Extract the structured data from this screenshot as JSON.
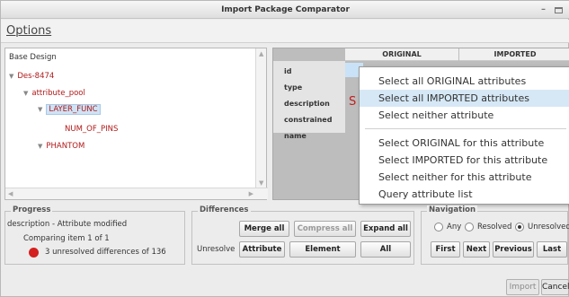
{
  "window": {
    "title": "Import Package Comparator"
  },
  "options_label": "Options",
  "tree": {
    "header": "Base Design",
    "items": [
      {
        "label": "Des-8474",
        "depth": 0,
        "expanded": true
      },
      {
        "label": "attribute_pool",
        "depth": 1,
        "expanded": true
      },
      {
        "label": "LAYER_FUNC",
        "depth": 2,
        "expanded": true,
        "selected": true
      },
      {
        "label": "NUM_OF_PINS",
        "depth": 3
      },
      {
        "label": "PHANTOM",
        "depth": 2,
        "expanded": true
      }
    ]
  },
  "attr_table": {
    "columns": [
      "ORIGINAL",
      "IMPORTED"
    ],
    "rows": [
      "id",
      "type",
      "description",
      "constrained",
      "name"
    ]
  },
  "context_menu": {
    "items": [
      "Select all ORIGINAL attributes",
      "Select all IMPORTED attributes",
      "Select neither attribute",
      "Select ORIGINAL for this attribute",
      "Select IMPORTED for this attribute",
      "Select neither for this attribute",
      "Query attribute list"
    ],
    "highlighted_index": 1
  },
  "progress": {
    "title": "Progress",
    "status": "description - Attribute modified",
    "comparing": "Comparing item 1 of 1",
    "unresolved": "3 unresolved differences of 136"
  },
  "differences": {
    "title": "Differences",
    "merge_all": "Merge all",
    "compress_all": "Compress all",
    "expand_all": "Expand all",
    "unresolve_label": "Unresolve",
    "attribute": "Attribute",
    "element": "Element",
    "all": "All"
  },
  "navigation": {
    "title": "Navigation",
    "options": [
      "Any",
      "Resolved",
      "Unresolved"
    ],
    "selected": "Unresolved",
    "first": "First",
    "next": "Next",
    "previous": "Previous",
    "last": "Last"
  },
  "footer": {
    "import": "Import",
    "cancel": "Cancel"
  },
  "colors": {
    "selection": "#d6e8f6",
    "tree_red": "#b01818",
    "error_dot": "#d42020"
  }
}
